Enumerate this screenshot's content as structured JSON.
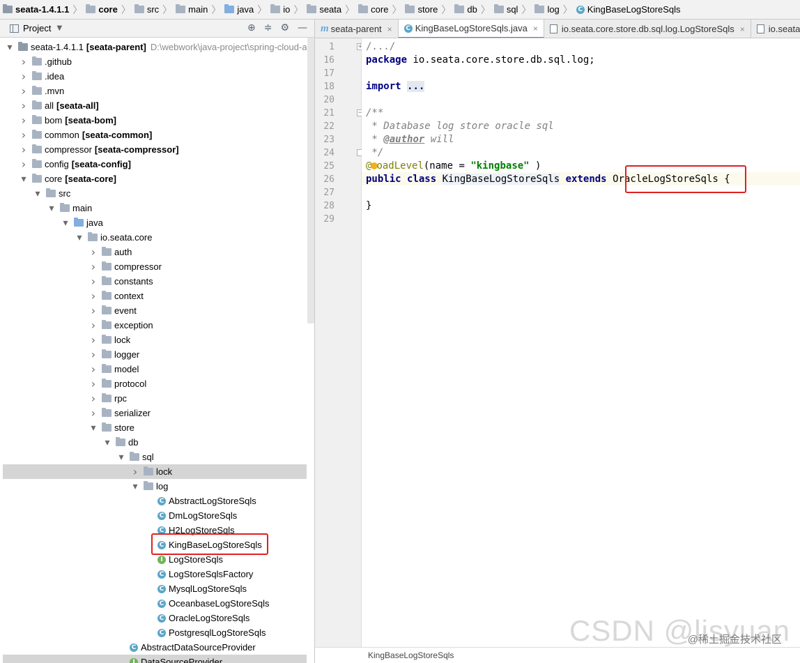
{
  "breadcrumb": [
    {
      "label": "seata-1.4.1.1",
      "icon": "project-icon",
      "bold": true
    },
    {
      "label": "core",
      "icon": "folder-icon",
      "bold": true
    },
    {
      "label": "src",
      "icon": "folder-icon"
    },
    {
      "label": "main",
      "icon": "folder-icon"
    },
    {
      "label": "java",
      "icon": "source-folder-icon"
    },
    {
      "label": "io",
      "icon": "folder-icon"
    },
    {
      "label": "seata",
      "icon": "folder-icon"
    },
    {
      "label": "core",
      "icon": "folder-icon"
    },
    {
      "label": "store",
      "icon": "folder-icon"
    },
    {
      "label": "db",
      "icon": "folder-icon"
    },
    {
      "label": "sql",
      "icon": "folder-icon"
    },
    {
      "label": "log",
      "icon": "folder-icon"
    },
    {
      "label": "KingBaseLogStoreSqls",
      "icon": "class-icon"
    }
  ],
  "project_panel": {
    "title": "Project",
    "tools": [
      "⊕",
      "≑",
      "⚙",
      "—"
    ]
  },
  "tree": [
    {
      "indent": 0,
      "arrow": "down",
      "icon": "project",
      "name": "seata-1.4.1.1",
      "module": "[seata-parent]",
      "path": "D:\\webwork\\java-project\\spring-cloud-al"
    },
    {
      "indent": 1,
      "arrow": "right",
      "icon": "folder",
      "name": ".github"
    },
    {
      "indent": 1,
      "arrow": "right",
      "icon": "folder",
      "name": ".idea"
    },
    {
      "indent": 1,
      "arrow": "right",
      "icon": "folder",
      "name": ".mvn"
    },
    {
      "indent": 1,
      "arrow": "right",
      "icon": "folder",
      "name": "all",
      "module": "[seata-all]"
    },
    {
      "indent": 1,
      "arrow": "right",
      "icon": "folder",
      "name": "bom",
      "module": "[seata-bom]"
    },
    {
      "indent": 1,
      "arrow": "right",
      "icon": "folder",
      "name": "common",
      "module": "[seata-common]"
    },
    {
      "indent": 1,
      "arrow": "right",
      "icon": "folder",
      "name": "compressor",
      "module": "[seata-compressor]"
    },
    {
      "indent": 1,
      "arrow": "right",
      "icon": "folder",
      "name": "config",
      "module": "[seata-config]"
    },
    {
      "indent": 1,
      "arrow": "down",
      "icon": "folder",
      "name": "core",
      "module": "[seata-core]"
    },
    {
      "indent": 2,
      "arrow": "down",
      "icon": "folder",
      "name": "src"
    },
    {
      "indent": 3,
      "arrow": "down",
      "icon": "folder",
      "name": "main"
    },
    {
      "indent": 4,
      "arrow": "down",
      "icon": "folder-blue",
      "name": "java"
    },
    {
      "indent": 5,
      "arrow": "down",
      "icon": "folder",
      "name": "io.seata.core"
    },
    {
      "indent": 6,
      "arrow": "right",
      "icon": "folder",
      "name": "auth"
    },
    {
      "indent": 6,
      "arrow": "right",
      "icon": "folder",
      "name": "compressor"
    },
    {
      "indent": 6,
      "arrow": "right",
      "icon": "folder",
      "name": "constants"
    },
    {
      "indent": 6,
      "arrow": "right",
      "icon": "folder",
      "name": "context"
    },
    {
      "indent": 6,
      "arrow": "right",
      "icon": "folder",
      "name": "event"
    },
    {
      "indent": 6,
      "arrow": "right",
      "icon": "folder",
      "name": "exception"
    },
    {
      "indent": 6,
      "arrow": "right",
      "icon": "folder",
      "name": "lock"
    },
    {
      "indent": 6,
      "arrow": "right",
      "icon": "folder",
      "name": "logger"
    },
    {
      "indent": 6,
      "arrow": "right",
      "icon": "folder",
      "name": "model"
    },
    {
      "indent": 6,
      "arrow": "right",
      "icon": "folder",
      "name": "protocol"
    },
    {
      "indent": 6,
      "arrow": "right",
      "icon": "folder",
      "name": "rpc"
    },
    {
      "indent": 6,
      "arrow": "right",
      "icon": "folder",
      "name": "serializer"
    },
    {
      "indent": 6,
      "arrow": "down",
      "icon": "folder",
      "name": "store"
    },
    {
      "indent": 7,
      "arrow": "down",
      "icon": "folder",
      "name": "db"
    },
    {
      "indent": 8,
      "arrow": "down",
      "icon": "folder",
      "name": "sql"
    },
    {
      "indent": 9,
      "arrow": "right",
      "icon": "folder",
      "name": "lock",
      "selected": true
    },
    {
      "indent": 9,
      "arrow": "down",
      "icon": "folder",
      "name": "log"
    },
    {
      "indent": 10,
      "arrow": "none",
      "icon": "class",
      "name": "AbstractLogStoreSqls"
    },
    {
      "indent": 10,
      "arrow": "none",
      "icon": "class",
      "name": "DmLogStoreSqls"
    },
    {
      "indent": 10,
      "arrow": "none",
      "icon": "class",
      "name": "H2LogStoreSqls"
    },
    {
      "indent": 10,
      "arrow": "none",
      "icon": "class",
      "name": "KingBaseLogStoreSqls",
      "highlight": true
    },
    {
      "indent": 10,
      "arrow": "none",
      "icon": "interface",
      "name": "LogStoreSqls"
    },
    {
      "indent": 10,
      "arrow": "none",
      "icon": "class",
      "name": "LogStoreSqlsFactory"
    },
    {
      "indent": 10,
      "arrow": "none",
      "icon": "class",
      "name": "MysqlLogStoreSqls"
    },
    {
      "indent": 10,
      "arrow": "none",
      "icon": "class",
      "name": "OceanbaseLogStoreSqls"
    },
    {
      "indent": 10,
      "arrow": "none",
      "icon": "class",
      "name": "OracleLogStoreSqls"
    },
    {
      "indent": 10,
      "arrow": "none",
      "icon": "class",
      "name": "PostgresqlLogStoreSqls"
    },
    {
      "indent": 8,
      "arrow": "none",
      "icon": "class",
      "name": "AbstractDataSourceProvider"
    },
    {
      "indent": 8,
      "arrow": "none",
      "icon": "interface",
      "name": "DataSourceProvider",
      "selected": true
    }
  ],
  "tabs": [
    {
      "label": "seata-parent",
      "icon": "maven-icon",
      "active": false
    },
    {
      "label": "KingBaseLogStoreSqls.java",
      "icon": "class-icon",
      "active": true
    },
    {
      "label": "io.seata.core.store.db.sql.log.LogStoreSqls",
      "icon": "file-icon",
      "active": false
    },
    {
      "label": "io.seata.c",
      "icon": "file-icon",
      "active": false
    }
  ],
  "editor": {
    "line_numbers": [
      "1",
      "16",
      "17",
      "18",
      "20",
      "21",
      "22",
      "23",
      "24",
      "25",
      "26",
      "27",
      "28",
      "29"
    ],
    "code": {
      "l1": "/.../",
      "l16_kw": "package",
      "l16_rest": " io.seata.core.store.db.sql.log;",
      "l18_kw": "import",
      "l18_fold": "...",
      "l21": "/**",
      "l22": " * Database log store oracle sql",
      "l23_pre": " * ",
      "l23_tag": "@author",
      "l23_rest": " will",
      "l24": " */",
      "l25_at": "@",
      "l25_ann": "oadLevel",
      "l25_open": "(name = ",
      "l25_str": "\"kingbase\"",
      "l25_close": " )",
      "l26_kw1": "public class",
      "l26_cls": "KingBaseLogStoreSqls",
      "l26_kw2": "extends",
      "l26_parent": "OracleLogStoreSqls",
      "l26_brace": " {",
      "l28": "}"
    }
  },
  "status_bar": {
    "text": "KingBaseLogStoreSqls"
  },
  "watermark": {
    "big": "CSDN @lisyuan",
    "small": "@稀土掘金技术社区"
  }
}
